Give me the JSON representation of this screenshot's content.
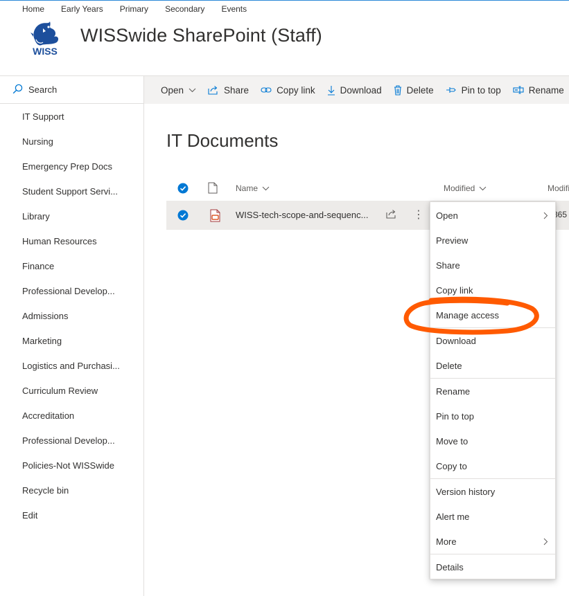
{
  "top_nav": [
    "Home",
    "Early Years",
    "Primary",
    "Secondary",
    "Events"
  ],
  "site": {
    "title": "WISSwide SharePoint (Staff)",
    "logo_text": "WISS"
  },
  "left_nav": {
    "search_label": "Search",
    "items": [
      "IT Support",
      "Nursing",
      "Emergency Prep Docs",
      "Student Support Servi...",
      "Library",
      "Human Resources",
      "Finance",
      "Professional Develop...",
      "Admissions",
      "Marketing",
      "Logistics and Purchasi...",
      "Curriculum Review",
      "Accreditation",
      "Professional Develop...",
      "Policies-Not WISSwide",
      "Recycle bin",
      "Edit"
    ]
  },
  "command_bar": {
    "open": "Open",
    "share": "Share",
    "copy_link": "Copy link",
    "download": "Download",
    "delete": "Delete",
    "pin_to_top": "Pin to top",
    "rename": "Rename"
  },
  "library": {
    "title": "IT Documents",
    "columns": {
      "name": "Name",
      "modified": "Modified",
      "modified_by": "Modifi"
    },
    "rows": [
      {
        "name": "WISS-tech-scope-and-sequenc...",
        "modified_by_partial": "365"
      }
    ]
  },
  "context_menu": {
    "items": [
      "Open",
      "Preview",
      "Share",
      "Copy link",
      "Manage access",
      "Download",
      "Delete",
      "Rename",
      "Pin to top",
      "Move to",
      "Copy to",
      "Version history",
      "Alert me",
      "More",
      "Details"
    ]
  },
  "colors": {
    "accent": "#0078d4",
    "annotation": "#ff5a00",
    "command_bar_bg": "#f3f2f1",
    "selected_row_bg": "#edebe9",
    "logo_blue": "#1d4f9c"
  }
}
